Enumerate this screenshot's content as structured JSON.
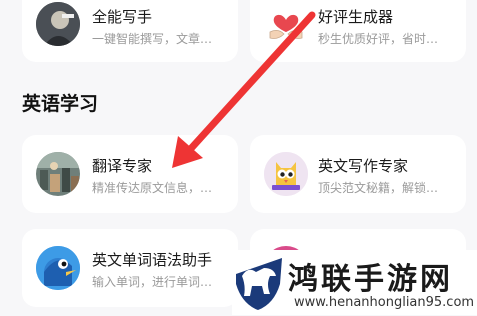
{
  "top_cards": [
    {
      "title": "全能写手",
      "subtitle": "一键智能撰写，文章…",
      "icon": "writer-avatar-icon"
    },
    {
      "title": "好评生成器",
      "subtitle": "秒生优质好评，省时…",
      "icon": "heart-hands-icon"
    }
  ],
  "section": {
    "title": "英语学习"
  },
  "cards": [
    {
      "title": "翻译专家",
      "subtitle": "精准传达原文信息，…",
      "icon": "translator-avatar-icon"
    },
    {
      "title": "英文写作专家",
      "subtitle": "顶尖范文秘籍，解锁…",
      "icon": "owl-book-icon"
    },
    {
      "title": "英文单词语法助手",
      "subtitle": "输入单词，进行单词…",
      "icon": "bird-mascot-icon"
    }
  ],
  "watermark": {
    "title": "鸿联手游网",
    "url": "www.henanhonglian95.com"
  },
  "colors": {
    "arrow": "#ee3434",
    "card": "#ffffff",
    "background": "#f7f7f9",
    "subtitle": "#9a9a9a"
  }
}
